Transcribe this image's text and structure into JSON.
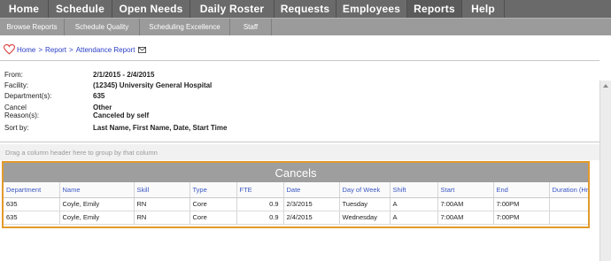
{
  "topnav": [
    {
      "label": "Home"
    },
    {
      "label": "Schedule"
    },
    {
      "label": "Open Needs"
    },
    {
      "label": "Daily Roster"
    },
    {
      "label": "Requests"
    },
    {
      "label": "Employees"
    },
    {
      "label": "Reports"
    },
    {
      "label": "Help"
    }
  ],
  "subnav": [
    {
      "label": "Browse Reports"
    },
    {
      "label": "Schedule Quality"
    },
    {
      "label": "Scheduling Excellence"
    },
    {
      "label": "Staff"
    }
  ],
  "breadcrumb": {
    "home": "Home",
    "sep1": ">",
    "report": "Report",
    "sep2": ">",
    "current": "Attendance Report"
  },
  "info": {
    "from_label": "From:",
    "from_value": "2/1/2015 - 2/4/2015",
    "facility_label": "Facility:",
    "facility_value": "(12345) University General Hospital",
    "departments_label": "Department(s):",
    "departments_value": "635",
    "cancel_label_1": "Cancel",
    "cancel_label_2": "Reason(s):",
    "cancel_value_1": "Other",
    "cancel_value_2": "Canceled by self",
    "sortby_label": "Sort by:",
    "sortby_value": "Last Name, First Name, Date, Start Time"
  },
  "groupbar": {
    "text": "Drag a column header here to group by that column"
  },
  "grid": {
    "title": "Cancels",
    "columns": [
      "Department",
      "Name",
      "Skill",
      "Type",
      "FTE",
      "Date",
      "Day of Week",
      "Shift",
      "Start",
      "End",
      "Duration (Hr"
    ],
    "rows": [
      [
        "635",
        "Coyle, Emily",
        "RN",
        "Core",
        "0.9",
        "2/3/2015",
        "Tuesday",
        "A",
        "7:00AM",
        "7:00PM",
        ""
      ],
      [
        "635",
        "Coyle, Emily",
        "RN",
        "Core",
        "0.9",
        "2/4/2015",
        "Wednesday",
        "A",
        "7:00AM",
        "7:00PM",
        ""
      ]
    ]
  },
  "colors": {
    "accent_border": "#e39a2b",
    "nav_bg": "#6a6a6a",
    "link": "#2a3ec4"
  }
}
